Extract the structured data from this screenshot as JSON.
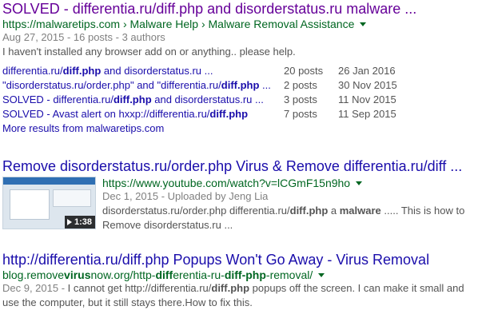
{
  "results": [
    {
      "title": "SOLVED - differentia.ru/diff.php and disorderstatus.ru malware ...",
      "cite": "https://malwaretips.com › Malware Help › Malware Removal Assistance",
      "meta": "Aug 27, 2015 - 16 posts - 3 authors",
      "snippet": "I haven't installed any browser add on or anything.. please help.",
      "sitelinks": [
        {
          "pre": "differentia.ru/",
          "bold": "diff.php",
          "post": " and disorderstatus.ru ...",
          "posts": "20 posts",
          "date": "26 Jan 2016"
        },
        {
          "pre": "\"disorderstatus.ru/order.php\" and \"differentia.ru/",
          "bold": "diff.php",
          "post": " ...",
          "posts": "2 posts",
          "date": "30 Nov 2015"
        },
        {
          "pre": "SOLVED - differentia.ru/",
          "bold": "diff.php",
          "post": " and disorderstatus.ru ...",
          "posts": "3 posts",
          "date": "11 Nov 2015"
        },
        {
          "pre": "SOLVED - Avast alert on hxxp://differentia.ru/",
          "bold": "diff.php",
          "post": "",
          "posts": "7 posts",
          "date": "11 Sep 2015"
        }
      ],
      "more": "More results from malwaretips.com"
    },
    {
      "title": "Remove disorderstatus.ru/order.php Virus & Remove differentia.ru/diff ...",
      "cite": "https://www.youtube.com/watch?v=lCGmF15n9ho",
      "meta": "Dec 1, 2015 - Uploaded by Jeng Lia",
      "duration": "1:38",
      "snippet": {
        "line1_pre": "disorderstatus.ru/order.php differentia.ru/",
        "line1_b1": "diff.php",
        "line1_mid": " a ",
        "line1_b2": "malware",
        "line1_post": " ..... This is how to",
        "line2": "Remove disorderstatus.ru ..."
      }
    },
    {
      "title": "http://differentia.ru/diff.php Popups Won't Go Away - Virus Removal",
      "cite": {
        "p1": "blog.remove",
        "b1": "virus",
        "p2": "now.org/http-",
        "b2": "diff",
        "p3": "erentia-ru-",
        "b3": "diff-php",
        "p4": "-removal/"
      },
      "meta": "Dec 9, 2015 - ",
      "snippet": {
        "pre": "I cannot get http://differentia.ru/",
        "bold": "diff.php",
        "post": " popups off the screen. I can make it small and use the computer, but it still stays there.How to fix this."
      }
    }
  ]
}
